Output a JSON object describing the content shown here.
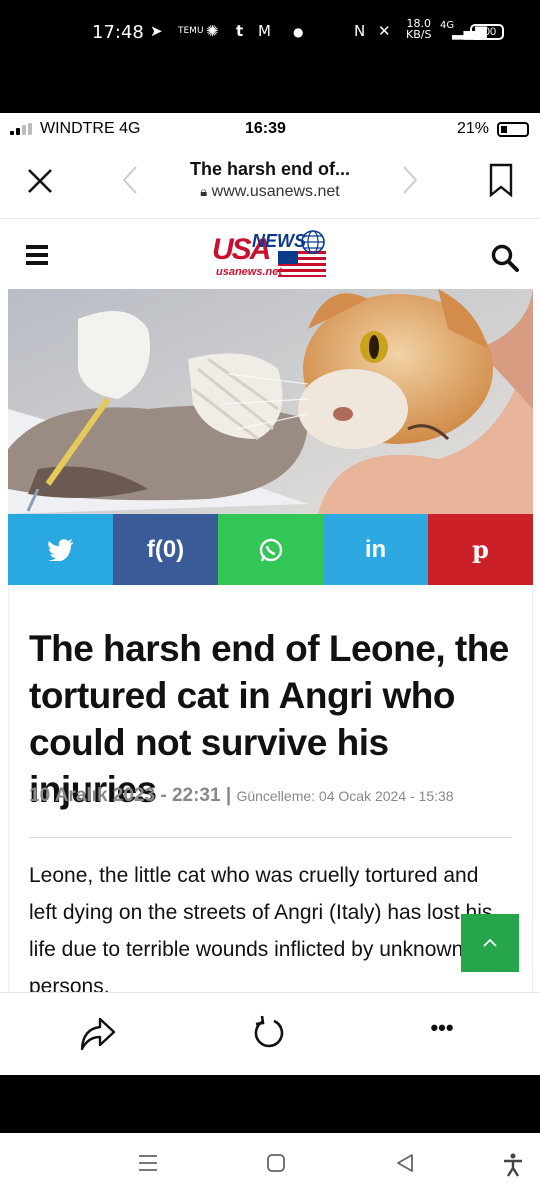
{
  "outer_status": {
    "time": "17:48",
    "battery": "100",
    "net_speed": "18.0",
    "net_unit": "KB/S",
    "signal_label": "4G"
  },
  "inner_status": {
    "carrier": "WINDTRE  4G",
    "time": "16:39",
    "battery_pct": "21%"
  },
  "browser": {
    "page_title": "The harsh end of...",
    "url": "www.usanews.net"
  },
  "site": {
    "logo_main": "USA",
    "logo_news": "NEWS",
    "logo_sub": "usanews.net"
  },
  "share": {
    "facebook_label": "f(0)",
    "linkedin_label": "in",
    "pinterest_label": "p",
    "icons": [
      "twitter-icon",
      "facebook-icon",
      "whatsapp-icon",
      "linkedin-icon",
      "pinterest-icon"
    ]
  },
  "article": {
    "headline": "The harsh end of Leone, the tortured cat in Angri who could not survive his injuries",
    "date": "10 Aralık 2023 - 22:31",
    "updated": "Güncelleme: 04 Ocak 2024 - 15:38",
    "body": "Leone, the little cat who was cruelly tortured and left dying on the streets of Angri (Italy) has lost his life due to terrible wounds inflicted by unknown persons."
  },
  "colors": {
    "twitter": "#29a7e1",
    "facebook": "#3b5b98",
    "whatsapp": "#31c655",
    "linkedin": "#2ea8e0",
    "pinterest": "#cb2027",
    "to_top": "#27a54a",
    "brand_red": "#c8102e",
    "brand_blue": "#0b3a8c"
  }
}
